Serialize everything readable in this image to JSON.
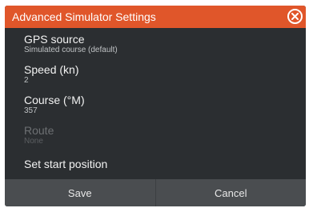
{
  "dialog": {
    "title": "Advanced Simulator Settings",
    "close_icon": "close-circle-icon"
  },
  "items": [
    {
      "label": "GPS source",
      "value": "Simulated course (default)",
      "enabled": true
    },
    {
      "label": "Speed (kn)",
      "value": "2",
      "enabled": true
    },
    {
      "label": "Course (°M)",
      "value": "357",
      "enabled": true
    },
    {
      "label": "Route",
      "value": "None",
      "enabled": false
    },
    {
      "label": "Set start position",
      "enabled": true
    }
  ],
  "footer": {
    "save_label": "Save",
    "cancel_label": "Cancel"
  },
  "colors": {
    "accent": "#e0562a",
    "background": "#2b2e31",
    "footer": "#4a4d50"
  }
}
